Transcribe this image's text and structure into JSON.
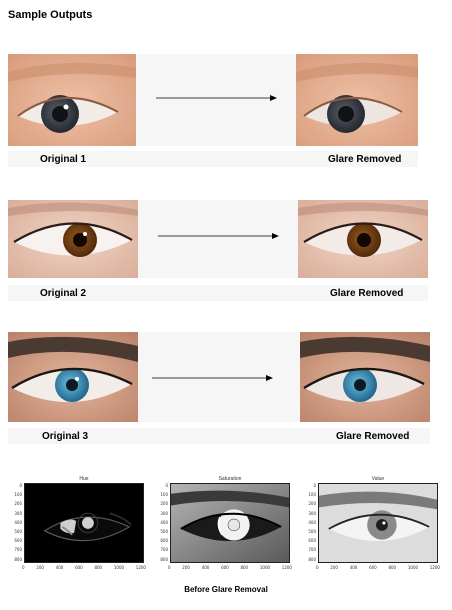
{
  "header": {
    "title": "Sample Outputs"
  },
  "rows": [
    {
      "left_label": "Original 1",
      "right_label": "Glare Removed"
    },
    {
      "left_label": "Original 2",
      "right_label": "Glare Removed"
    },
    {
      "left_label": "Original 3",
      "right_label": "Glare Removed"
    }
  ],
  "plots": [
    {
      "title": "Hue"
    },
    {
      "title": "Saturation"
    },
    {
      "title": "Value"
    }
  ],
  "axis": {
    "y_ticks": [
      "0",
      "100",
      "200",
      "300",
      "400",
      "500",
      "600",
      "700",
      "800"
    ],
    "x_ticks": [
      "0",
      "200",
      "400",
      "600",
      "800",
      "1000",
      "1200"
    ]
  },
  "footer": {
    "caption": "Before Glare Removal"
  },
  "colors": {
    "skin_light": "#e8b59a",
    "iris_dark": "#3b3f48",
    "iris_brown": "#6b3a14",
    "iris_blue": "#3a8fb8"
  }
}
